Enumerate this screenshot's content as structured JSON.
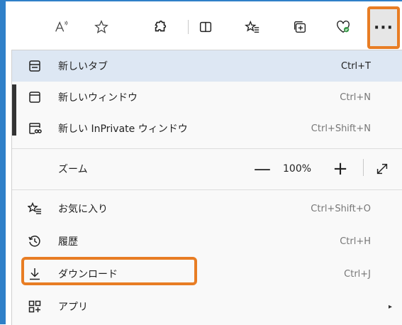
{
  "toolbar": {
    "icons": [
      "read-aloud-icon",
      "favorite-star-icon",
      "extensions-icon",
      "split-screen-icon",
      "favorites-icon",
      "collections-icon",
      "browser-essentials-icon"
    ],
    "read_aloud_glyph": "A",
    "more_label": "···"
  },
  "menu": {
    "new_tab": {
      "label": "新しいタブ",
      "shortcut": "Ctrl+T"
    },
    "new_window": {
      "label": "新しいウィンドウ",
      "shortcut": "Ctrl+N"
    },
    "new_inprivate": {
      "label": "新しい InPrivate ウィンドウ",
      "shortcut": "Ctrl+Shift+N"
    },
    "zoom": {
      "label": "ズーム",
      "minus": "—",
      "value": "100%",
      "plus": "+"
    },
    "favorites": {
      "label": "お気に入り",
      "shortcut": "Ctrl+Shift+O"
    },
    "history": {
      "label": "履歴",
      "shortcut": "Ctrl+H"
    },
    "downloads": {
      "label": "ダウンロード",
      "shortcut": "Ctrl+J"
    },
    "apps": {
      "label": "アプリ",
      "arrow": "▸"
    }
  },
  "colors": {
    "highlight_orange": "#e87d24",
    "hover_blue": "#dde7f3",
    "browser_edge_blue": "#2f80c8"
  }
}
